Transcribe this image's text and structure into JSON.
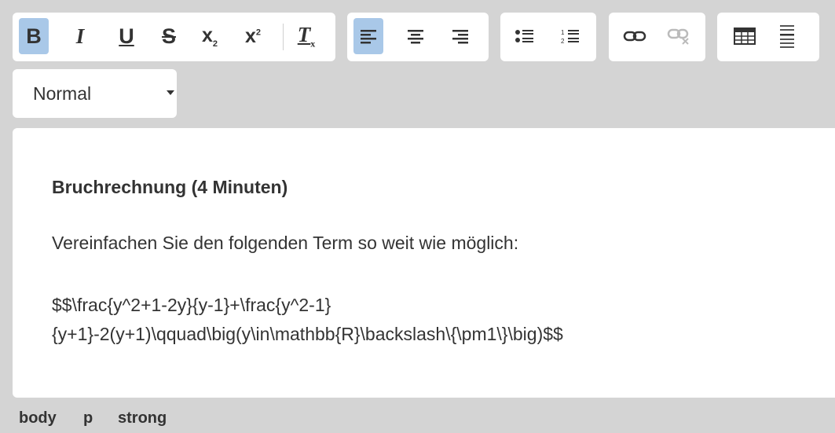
{
  "toolbar": {
    "bold": "B",
    "italic": "I",
    "underline": "U",
    "strike": "S",
    "subscript_base": "x",
    "subscript_sub": "2",
    "superscript_base": "x",
    "superscript_sup": "2",
    "clear_format": "T",
    "clear_format_sub": "x",
    "icons": [
      "bold-icon",
      "italic-icon",
      "underline-icon",
      "strikethrough-icon",
      "subscript-icon",
      "superscript-icon",
      "clear-format-icon",
      "align-left-icon",
      "align-center-icon",
      "align-right-icon",
      "bulleted-list-icon",
      "numbered-list-icon",
      "link-icon",
      "unlink-icon",
      "table-icon",
      "horizontal-rule-icon"
    ],
    "active_color": "#a9c8e8"
  },
  "format": {
    "value": "Normal"
  },
  "editor": {
    "heading": "Bruchrechnung (4 Minuten)",
    "paragraph": "Vereinfachen Sie den folgenden Term so weit wie möglich:",
    "formula_line1": "$$\\frac{y^2+1-2y}{y-1}+\\frac{y^2-1}",
    "formula_line2": "{y+1}-2(y+1)\\qquad\\big(y\\in\\mathbb{R}\\backslash\\{\\pm1\\}\\big)$$"
  },
  "statusbar": {
    "path": [
      "body",
      "p",
      "strong"
    ]
  }
}
